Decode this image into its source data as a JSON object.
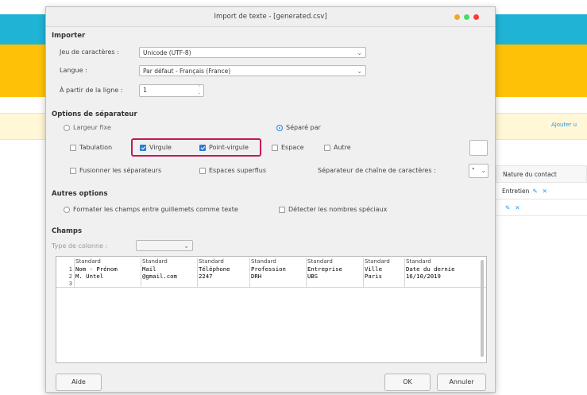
{
  "background": {
    "link_text": "Ajouter u",
    "table_header": "Nature du contact",
    "table_rows": [
      "Entretien",
      ""
    ]
  },
  "dialog": {
    "title": "Import de texte - [generated.csv]",
    "importer": {
      "heading": "Importer",
      "charset_label": "Jeu de caractères :",
      "charset_value": "Unicode (UTF-8)",
      "language_label": "Langue :",
      "language_value": "Par défaut - Français (France)",
      "from_line_label": "À partir de la ligne :",
      "from_line_value": "1"
    },
    "separator_options": {
      "heading": "Options de séparateur",
      "fixed_width": "Largeur fixe",
      "separated_by": "Séparé par",
      "tab": "Tabulation",
      "comma": "Virgule",
      "semicolon": "Point-virgule",
      "space": "Espace",
      "other": "Autre",
      "merge_delimiters": "Fusionner les séparateurs",
      "trim_spaces": "Espaces superflus",
      "string_delimiter_label": "Séparateur de chaîne de caractères :",
      "string_delimiter_value": "\""
    },
    "other_options": {
      "heading": "Autres options",
      "quoted_as_text": "Formater les champs entre guillemets comme texte",
      "detect_special": "Détecter les nombres spéciaux"
    },
    "fields": {
      "heading": "Champs",
      "column_type_label": "Type de colonne :",
      "column_type_value": ""
    },
    "preview": {
      "column_types": [
        "Standard",
        "Standard",
        "Standard",
        "Standard",
        "Standard",
        "Standard",
        "Standard"
      ],
      "rows": [
        {
          "num": "1",
          "cells": [
            "Nom - Prénom",
            "Mail",
            "Téléphone",
            "Profession",
            "Entreprise",
            "Ville",
            "Date du dernie"
          ]
        },
        {
          "num": "2",
          "cells": [
            "M. Untel",
            "@gmail.com",
            "2247",
            "DRH",
            "UBS",
            "Paris",
            "16/10/2019"
          ]
        },
        {
          "num": "3",
          "cells": [
            "",
            "",
            "",
            "",
            "",
            "",
            ""
          ]
        }
      ]
    },
    "buttons": {
      "help": "Aide",
      "ok": "OK",
      "cancel": "Annuler"
    },
    "window_dot_colors": [
      "#f5a623",
      "#4cd964",
      "#ff3b30"
    ]
  }
}
